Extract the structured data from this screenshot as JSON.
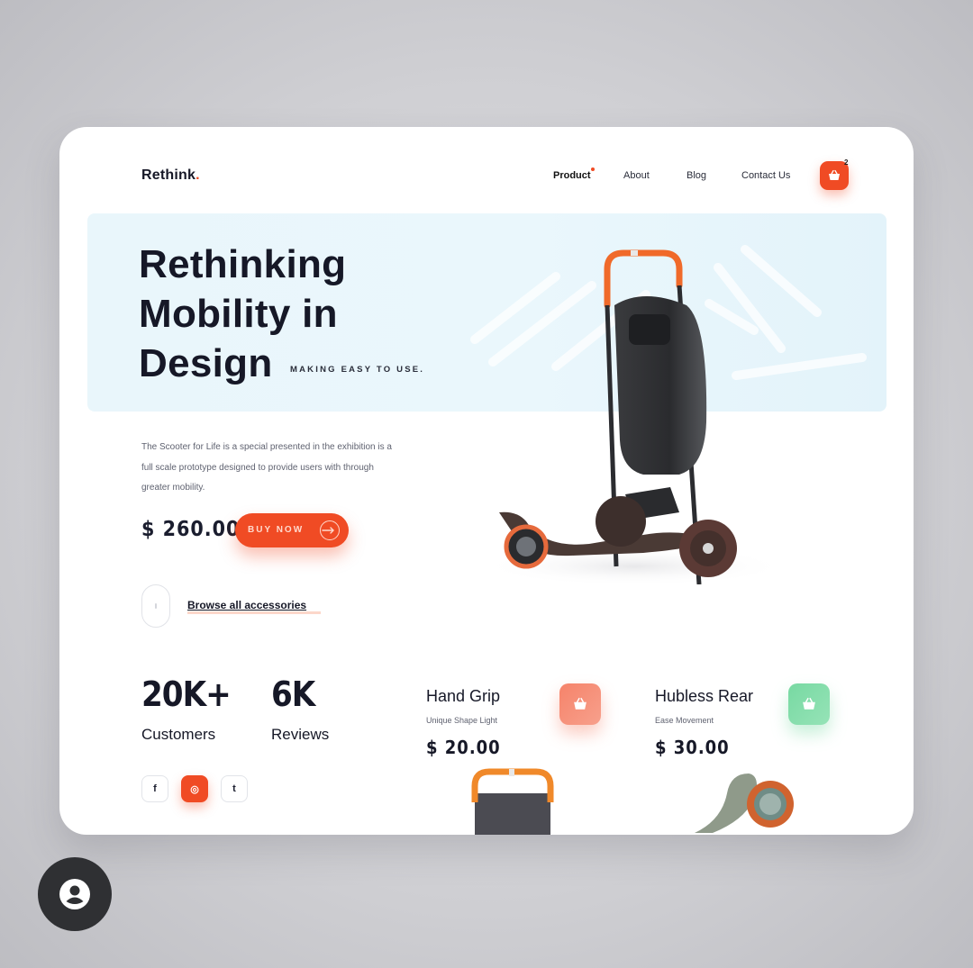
{
  "brand": {
    "name": "Rethink",
    "dot": "."
  },
  "nav": {
    "items": [
      {
        "label": "Product",
        "active": true
      },
      {
        "label": "About",
        "active": false
      },
      {
        "label": "Blog",
        "active": false
      },
      {
        "label": "Contact Us",
        "active": false
      }
    ],
    "cart_count": "2"
  },
  "hero": {
    "title_line1": "Rethinking",
    "title_line2": "Mobility in",
    "title_line3": "Design",
    "tagline": "MAKING EASY TO USE.",
    "description": "The Scooter for Life is a special presented in the exhibition is a full scale prototype designed to provide users with through greater mobility.",
    "price": "$ 260.00",
    "buy_label": "BUY NOW",
    "browse_label": "Browse all accessories"
  },
  "stats": [
    {
      "value": "20K+",
      "label": "Customers"
    },
    {
      "value": "6K",
      "label": "Reviews"
    }
  ],
  "social": [
    {
      "icon": "facebook-icon",
      "glyph": "f",
      "active": false
    },
    {
      "icon": "instagram-icon",
      "glyph": "◎",
      "active": true
    },
    {
      "icon": "twitter-icon",
      "glyph": "t",
      "active": false
    }
  ],
  "products": [
    {
      "name": "Hand Grip",
      "subtitle": "Unique Shape Light",
      "price": "$ 20.00",
      "cart_color": "#f6836a"
    },
    {
      "name": "Hubless Rear",
      "subtitle": "Ease Movement",
      "price": "$ 30.00",
      "cart_color": "#77d9a2"
    }
  ],
  "colors": {
    "accent": "#f04b24",
    "hero_bg": "#e9f6fb",
    "dark": "#161827"
  }
}
